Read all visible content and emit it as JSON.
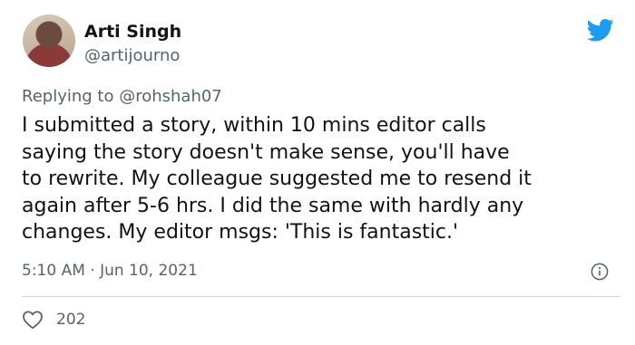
{
  "author": {
    "name": "Arti Singh",
    "handle": "@artijourno"
  },
  "reply": {
    "prefix": "Replying to ",
    "mention": "@rohshah07"
  },
  "tweet": {
    "text": "I submitted a story, within 10 mins editor calls\nsaying the story doesn't make sense, you'll have\nto rewrite. My colleague suggested me to resend it\nagain after 5-6 hrs. I did the same with hardly any\nchanges. My editor msgs: 'This is fantastic.'",
    "timestamp": "5:10 AM · Jun 10, 2021"
  },
  "engagement": {
    "likes": "202"
  },
  "icons": {
    "logo": "twitter-bird-icon",
    "info": "info-icon",
    "like": "heart-icon"
  },
  "colors": {
    "brand": "#1d9bf0",
    "secondary_text": "#536471",
    "primary_text": "#0f1419",
    "divider": "#cfd9de"
  }
}
